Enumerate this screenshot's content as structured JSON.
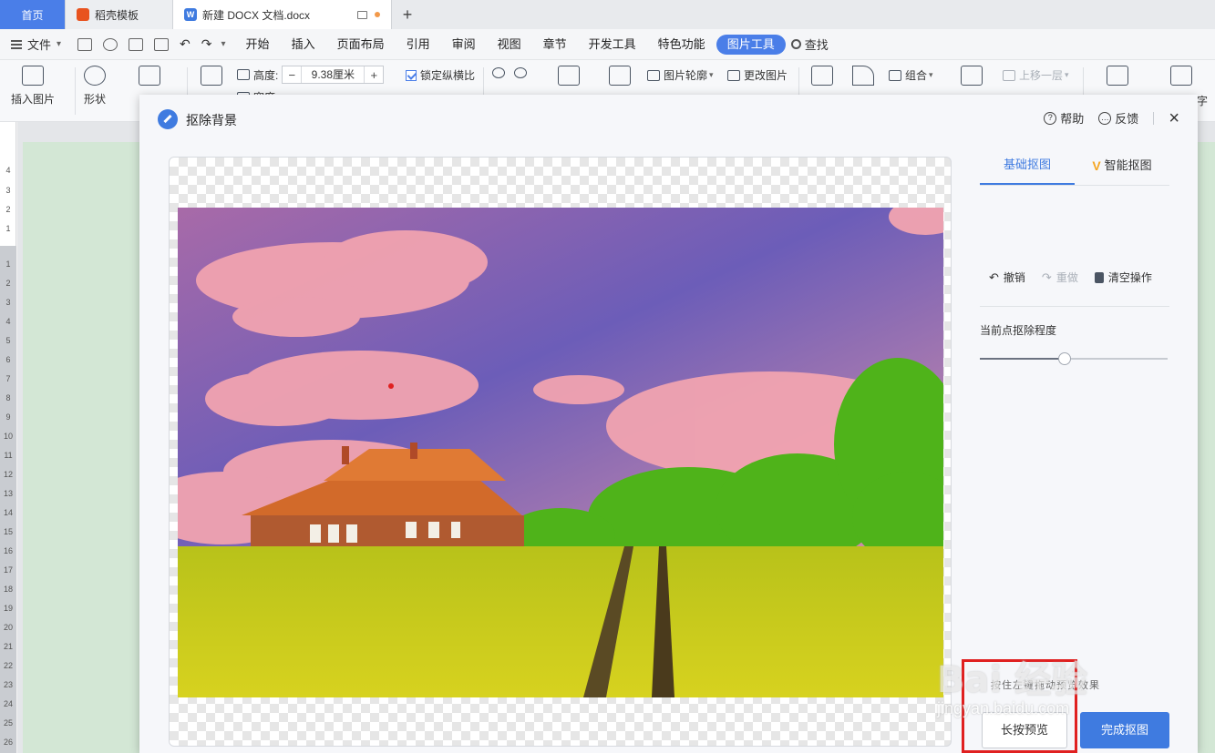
{
  "tabs": [
    {
      "label": "首页"
    },
    {
      "label": "稻壳模板"
    },
    {
      "label": "新建 DOCX 文档.docx"
    }
  ],
  "menubar": {
    "file_label": "文件",
    "items": [
      "开始",
      "插入",
      "页面布局",
      "引用",
      "审阅",
      "视图",
      "章节",
      "开发工具",
      "特色功能",
      "图片工具"
    ],
    "search_label": "查找"
  },
  "ribbon": {
    "insert_picture": "插入图片",
    "shape": "形状",
    "height_label": "高度:",
    "height_value": "9.38厘米",
    "width_label": "宽度:",
    "lock_ratio": "锁定纵横比",
    "outline": "图片轮廓",
    "change_picture": "更改图片",
    "group": "组合",
    "bring_forward": "上移一层",
    "partial_char": "字"
  },
  "ruler_numbers": [
    "4",
    "3",
    "2",
    "1",
    "1",
    "2",
    "3",
    "4",
    "5",
    "6",
    "7",
    "8",
    "9",
    "10",
    "11",
    "12",
    "13",
    "14",
    "15",
    "16",
    "17",
    "18",
    "19",
    "20",
    "21",
    "22",
    "23",
    "24",
    "25",
    "26"
  ],
  "dialog": {
    "title": "抠除背景",
    "help": "帮助",
    "feedback": "反馈",
    "panel": {
      "tab_basic": "基础抠图",
      "tab_smart": "智能抠图",
      "undo": "撤销",
      "redo": "重做",
      "clear": "清空操作",
      "slider_label": "当前点抠除程度",
      "slider_value": 0.45,
      "hint": "按住左键拖动预览效果",
      "preview_button": "长按预览",
      "done_button": "完成抠图"
    }
  },
  "watermark": {
    "main": "Bai 经验",
    "sub": "jingyan.baidu.com"
  },
  "colors": {
    "accent": "#3f7be0",
    "highlight_box": "#e02020"
  }
}
